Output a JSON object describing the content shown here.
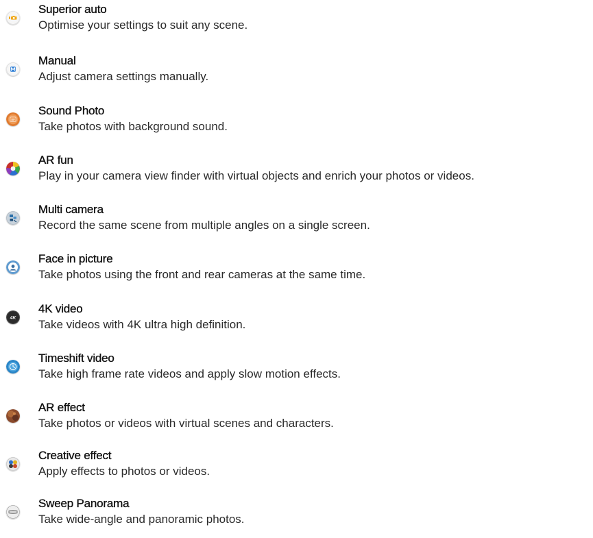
{
  "modes": [
    {
      "title": "Superior auto",
      "description": "Optimise your settings to suit any scene.",
      "icon": "superior-auto-camera-icon"
    },
    {
      "title": "Manual",
      "description": "Adjust camera settings manually.",
      "icon": "manual-m-icon"
    },
    {
      "title": "Sound Photo",
      "description": "Take photos with background sound.",
      "icon": "sound-photo-icon"
    },
    {
      "title": "AR fun",
      "description": "Play in your camera view finder with virtual objects and enrich your photos or videos.",
      "icon": "ar-fun-icon"
    },
    {
      "title": "Multi camera",
      "description": "Record the same scene from multiple angles on a single screen.",
      "icon": "multi-camera-icon"
    },
    {
      "title": "Face in picture",
      "description": "Take photos using the front and rear cameras at the same time.",
      "icon": "face-in-picture-icon"
    },
    {
      "title": "4K video",
      "description": "Take videos with 4K ultra high definition.",
      "icon": "4k-video-icon",
      "icon_text": "4K"
    },
    {
      "title": "Timeshift video",
      "description": "Take high frame rate videos and apply slow motion effects.",
      "icon": "timeshift-video-icon"
    },
    {
      "title": "AR effect",
      "description": "Take photos or videos with virtual scenes and characters.",
      "icon": "ar-effect-icon"
    },
    {
      "title": "Creative effect",
      "description": "Apply effects to photos or videos.",
      "icon": "creative-effect-icon"
    },
    {
      "title": "Sweep Panorama",
      "description": "Take wide-angle and panoramic photos.",
      "icon": "sweep-panorama-icon"
    }
  ],
  "colors": {
    "text_title": "#111111",
    "text_description": "#2a2a2a",
    "background": "#ffffff",
    "superior_auto_accent": "#f0a818",
    "manual_accent": "#2f7fd6",
    "sound_photo_accent": "#e07a2e",
    "timeshift_accent": "#2a86c8",
    "four_k_bg": "#2b2b2b"
  }
}
